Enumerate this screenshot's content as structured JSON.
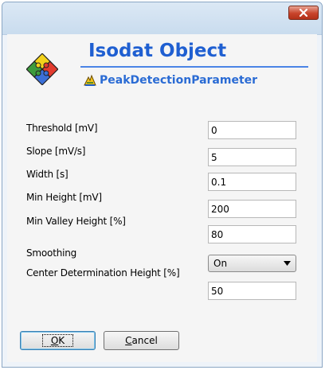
{
  "window": {
    "close_label": "close"
  },
  "header": {
    "app_title": "Isodat Object",
    "subtitle": "PeakDetectionParameter"
  },
  "fields": [
    {
      "label": "Threshold [mV]",
      "value": "0"
    },
    {
      "label": "Slope [mV/s]",
      "value": "5"
    },
    {
      "label": "Width [s]",
      "value": "0.1"
    },
    {
      "label": "Min Height [mV]",
      "value": "200"
    },
    {
      "label": "Min Valley Height [%]",
      "value": "80"
    }
  ],
  "smoothing": {
    "label": "Smoothing",
    "value": "On"
  },
  "center": {
    "label": "Center Determination Height [%]",
    "value": "50"
  },
  "buttons": {
    "ok_accel": "O",
    "ok_rest": "K",
    "cancel_accel": "C",
    "cancel_rest": "ancel"
  },
  "colors": {
    "title_blue": "#1f5fd1",
    "rule_blue": "#4a84e6",
    "close_red": "#c8442b"
  },
  "icons": {
    "logo": "puzzle-logo-icon",
    "subtitle": "peak-detection-icon",
    "close": "close-icon",
    "dropdown": "chevron-down-icon"
  }
}
